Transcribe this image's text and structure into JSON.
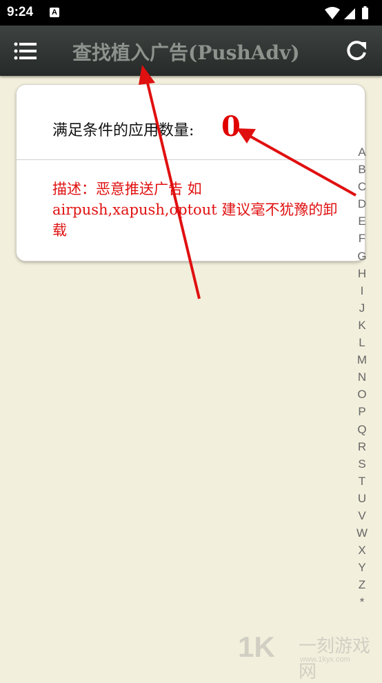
{
  "status_bar": {
    "time": "9:24",
    "notification_icon": "A"
  },
  "header": {
    "title": "查找植入广告(PushAdv)",
    "menu_icon": "hamburger-menu-icon",
    "refresh_icon": "refresh-icon"
  },
  "card": {
    "count_label": "满足条件的应用数量:",
    "count_value": "0",
    "description": "描述：恶意推送广告  如 airpush,xapush,optout 建议毫不犹豫的卸载"
  },
  "index_letters": [
    "A",
    "B",
    "C",
    "D",
    "E",
    "F",
    "G",
    "H",
    "I",
    "J",
    "K",
    "L",
    "M",
    "N",
    "O",
    "P",
    "Q",
    "R",
    "S",
    "T",
    "U",
    "V",
    "W",
    "X",
    "Y",
    "Z",
    "*"
  ],
  "watermark": {
    "logo": "1K",
    "name": "一刻游戏网",
    "url": "www.1kyx.com"
  },
  "colors": {
    "background": "#f2efdc",
    "appbar": "#2f3432",
    "accent_red": "#e00000"
  }
}
